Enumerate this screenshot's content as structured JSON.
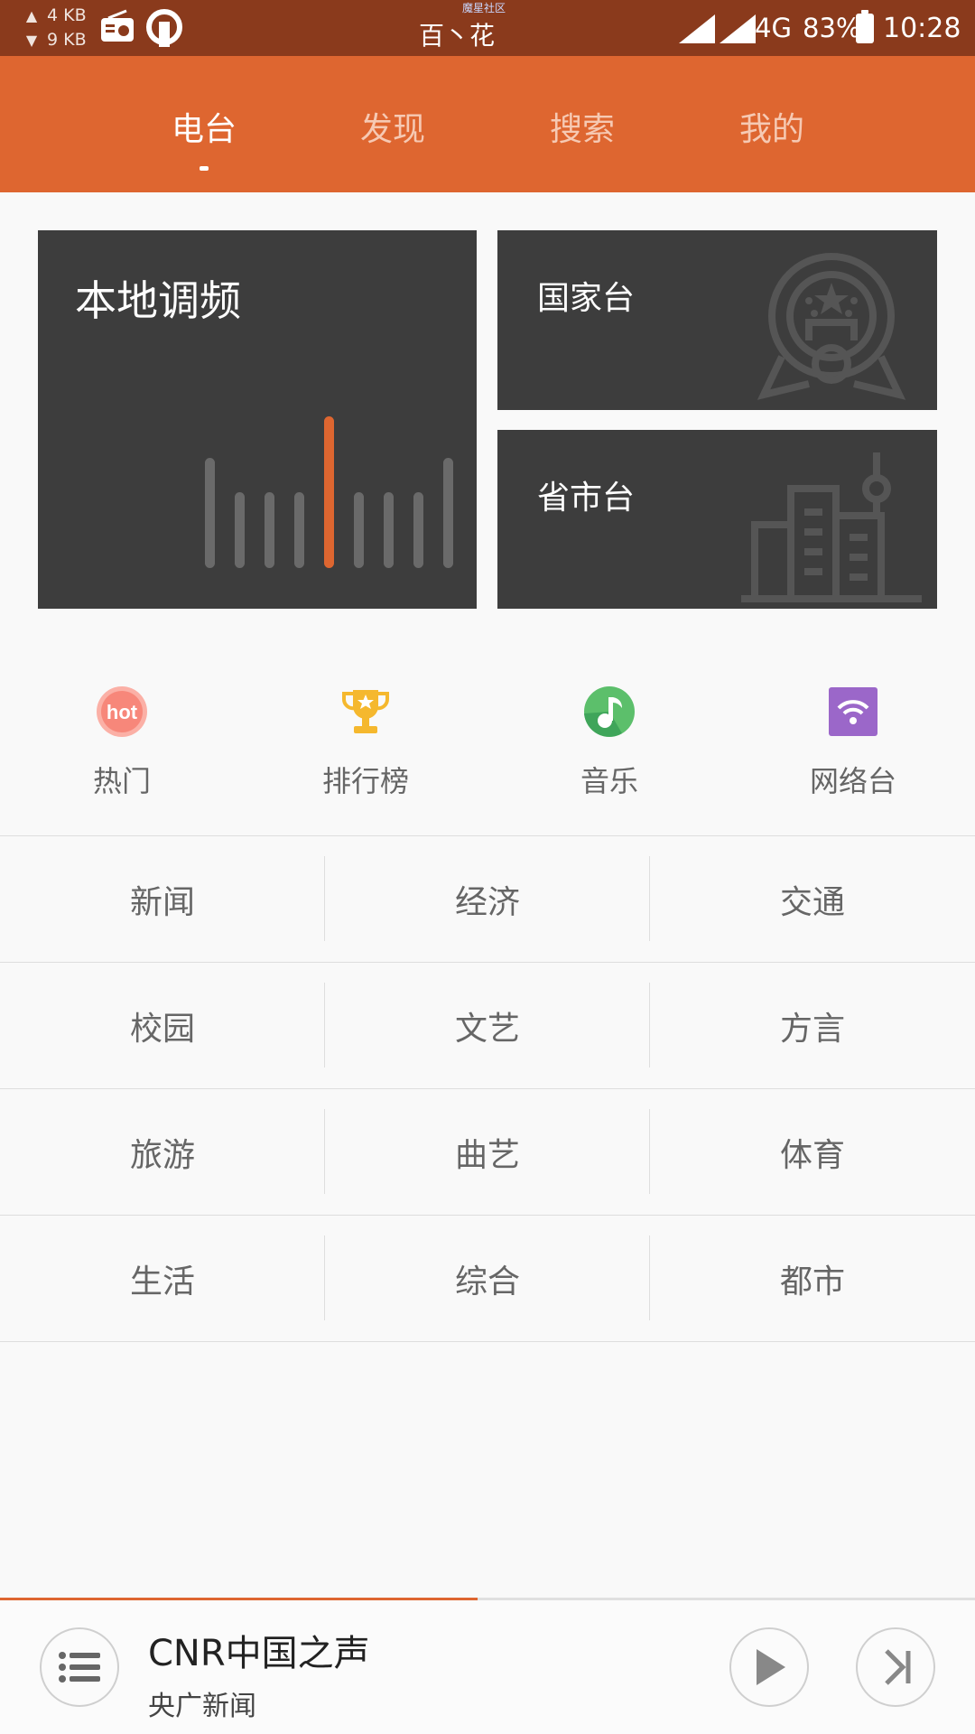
{
  "status_bar": {
    "upload_speed": "4 KB",
    "download_speed": "9 KB",
    "carrier": "百丶花",
    "carrier_sub": "魔星社区",
    "network_type": "4G",
    "battery": "83%",
    "time": "10:28"
  },
  "tabs": [
    {
      "label": "电台",
      "active": true
    },
    {
      "label": "发现",
      "active": false
    },
    {
      "label": "搜索",
      "active": false
    },
    {
      "label": "我的",
      "active": false
    }
  ],
  "cards": {
    "local": {
      "title": "本地调频"
    },
    "national": {
      "title": "国家台"
    },
    "provincial": {
      "title": "省市台"
    }
  },
  "shortcuts": [
    {
      "label": "热门",
      "icon": "hot-icon",
      "icon_text": "hot",
      "color": "#f7877a"
    },
    {
      "label": "排行榜",
      "icon": "trophy-icon",
      "color": "#f5b82e"
    },
    {
      "label": "音乐",
      "icon": "music-icon",
      "color": "#5cbf6b"
    },
    {
      "label": "网络台",
      "icon": "wifi-icon",
      "color": "#9b67c9"
    }
  ],
  "categories": [
    [
      "新闻",
      "经济",
      "交通"
    ],
    [
      "校园",
      "文艺",
      "方言"
    ],
    [
      "旅游",
      "曲艺",
      "体育"
    ],
    [
      "生活",
      "综合",
      "都市"
    ]
  ],
  "player": {
    "station": "CNR中国之声",
    "program": "央广新闻",
    "progress": 0.49
  },
  "colors": {
    "accent": "#de6630",
    "status_bar": "#8a3a1c",
    "card": "#3d3d3d"
  }
}
